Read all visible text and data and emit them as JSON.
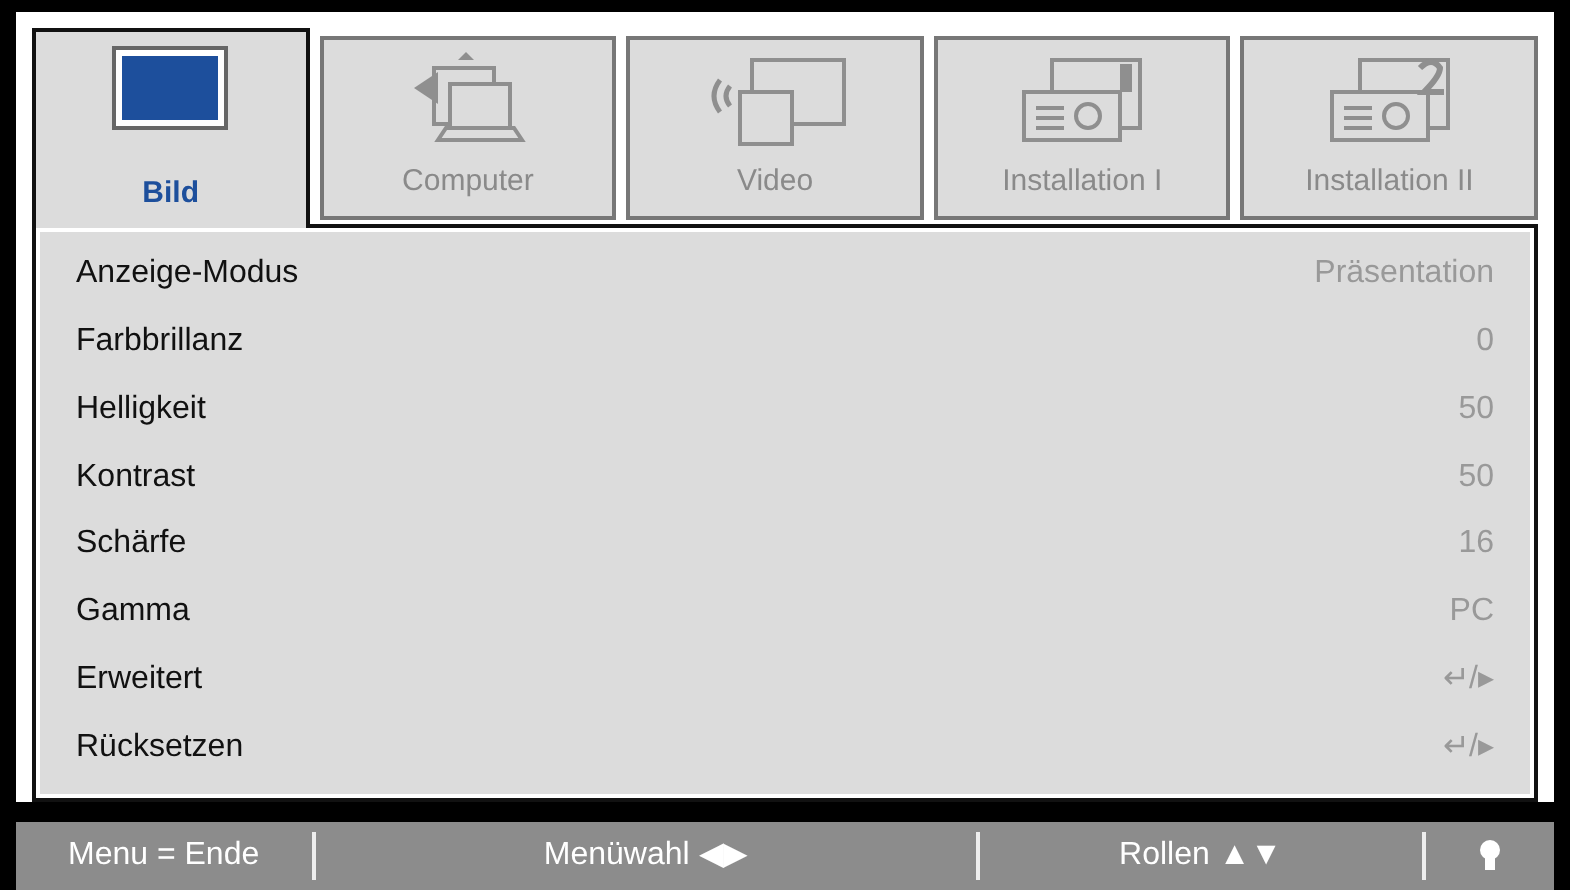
{
  "tabs": [
    {
      "label": "Bild",
      "kind": "picture-screen",
      "selected": true
    },
    {
      "label": "Computer",
      "kind": "computer",
      "selected": false
    },
    {
      "label": "Video",
      "kind": "video",
      "selected": false
    },
    {
      "label": "Installation I",
      "kind": "projector-1",
      "selected": false
    },
    {
      "label": "Installation II",
      "kind": "projector-2",
      "selected": false
    }
  ],
  "settings": [
    {
      "label": "Anzeige-Modus",
      "value": "Präsentation"
    },
    {
      "label": "Farbbrillanz",
      "value": "0"
    },
    {
      "label": "Helligkeit",
      "value": "50"
    },
    {
      "label": "Kontrast",
      "value": "50"
    },
    {
      "label": "Schärfe",
      "value": "16"
    },
    {
      "label": "Gamma",
      "value": "PC"
    },
    {
      "label": "Erweitert",
      "value": "↵/▸"
    },
    {
      "label": "Rücksetzen",
      "value": "↵/▸"
    }
  ],
  "status_bar": [
    {
      "kind": "text",
      "text": "Menu = Ende"
    },
    {
      "kind": "text",
      "text": "Menüwahl ◀▶"
    },
    {
      "kind": "text",
      "text": "Rollen ▲▼"
    },
    {
      "kind": "bulb"
    }
  ]
}
